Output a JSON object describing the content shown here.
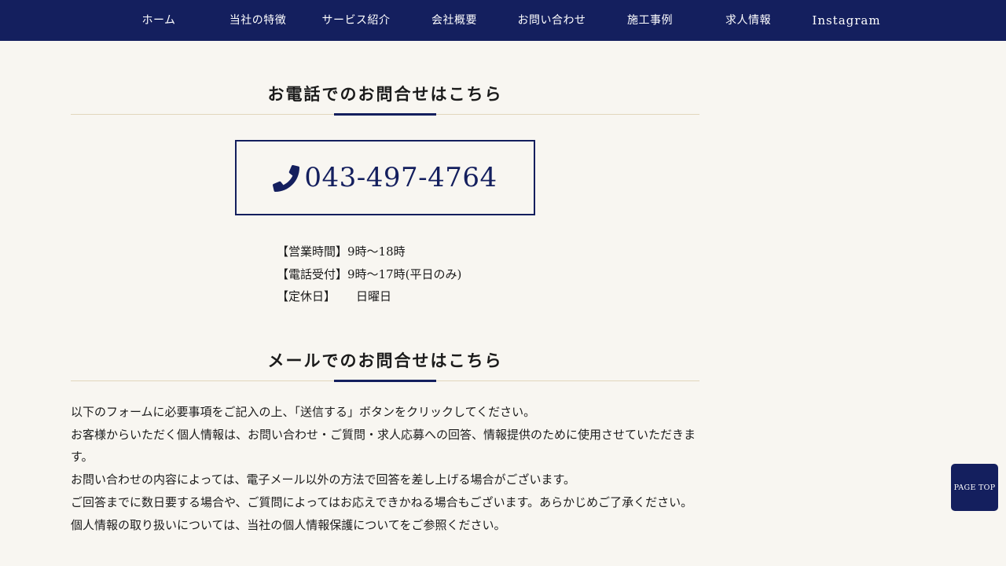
{
  "nav": {
    "items": [
      {
        "label": "ホーム"
      },
      {
        "label": "当社の特徴"
      },
      {
        "label": "サービス紹介"
      },
      {
        "label": "会社概要"
      },
      {
        "label": "お問い合わせ"
      },
      {
        "label": "施工事例"
      },
      {
        "label": "求人情報"
      },
      {
        "label": "Instagram"
      }
    ]
  },
  "phone_section": {
    "title": "お電話でのお問合せはこちら",
    "phone_icon": "phone-icon",
    "number": "043-497-4764",
    "hours": [
      {
        "label": "【営業時間】",
        "value": "9時〜18時"
      },
      {
        "label": "【電話受付】",
        "value": "9時〜17時(平日のみ)"
      },
      {
        "label": "【定休日】",
        "value": "日曜日"
      }
    ]
  },
  "mail_section": {
    "title": "メールでのお問合せはこちら",
    "paragraphs": [
      "以下のフォームに必要事項をご記入の上、「送信する」ボタンをクリックしてください。",
      "お客様からいただく個人情報は、お問い合わせ・ご質問・求人応募への回答、情報提供のために使用させていただきます。",
      "お問い合わせの内容によっては、電子メール以外の方法で回答を差し上げる場合がございます。",
      "ご回答までに数日要する場合や、ご質問によってはお応えできかねる場合もございます。あらかじめご了承ください。",
      "個人情報の取り扱いについては、当社の個人情報保護についてをご参照ください。"
    ]
  },
  "page_top": {
    "label": "PAGE TOP"
  },
  "colors": {
    "accent": "#141f5e",
    "background": "#f8f6f1",
    "rule": "#e2d6bd"
  }
}
